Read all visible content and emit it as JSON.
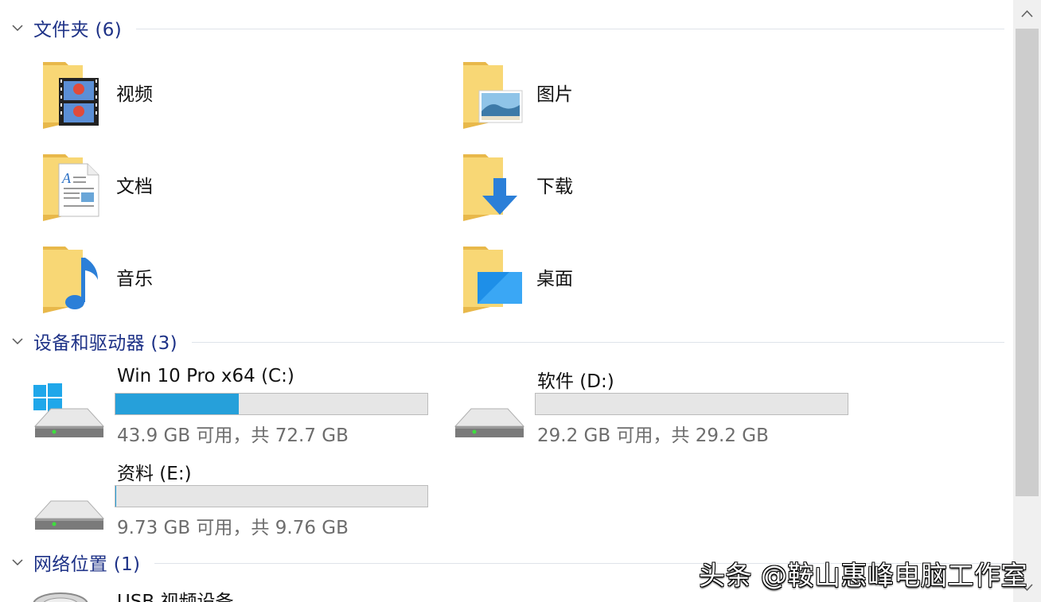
{
  "groups": {
    "folders": {
      "title": "文件夹 (6)"
    },
    "devices": {
      "title": "设备和驱动器 (3)"
    },
    "network": {
      "title": "网络位置 (1)"
    }
  },
  "folders": [
    {
      "label": "视频",
      "icon": "video-folder-icon"
    },
    {
      "label": "图片",
      "icon": "pictures-folder-icon"
    },
    {
      "label": "文档",
      "icon": "documents-folder-icon"
    },
    {
      "label": "下载",
      "icon": "downloads-folder-icon"
    },
    {
      "label": "音乐",
      "icon": "music-folder-icon"
    },
    {
      "label": "桌面",
      "icon": "desktop-folder-icon"
    }
  ],
  "drives": [
    {
      "name": "Win 10 Pro x64 (C:)",
      "free_text": "43.9 GB 可用，共 72.7 GB",
      "used_fraction": 0.396,
      "icon": "windows-drive-icon"
    },
    {
      "name": "软件 (D:)",
      "free_text": "29.2 GB 可用，共 29.2 GB",
      "used_fraction": 0.0,
      "icon": "hard-drive-icon"
    },
    {
      "name": "资料 (E:)",
      "free_text": "9.73 GB 可用，共 9.76 GB",
      "used_fraction": 0.003,
      "icon": "hard-drive-icon"
    }
  ],
  "network_items": [
    {
      "label": "USB 视频设备",
      "icon": "webcam-icon"
    }
  ],
  "watermark": "头条 @鞍山惠峰电脑工作室",
  "colors": {
    "accent": "#26a0da",
    "group_title": "#1e3287",
    "folder": "#f8d775"
  }
}
